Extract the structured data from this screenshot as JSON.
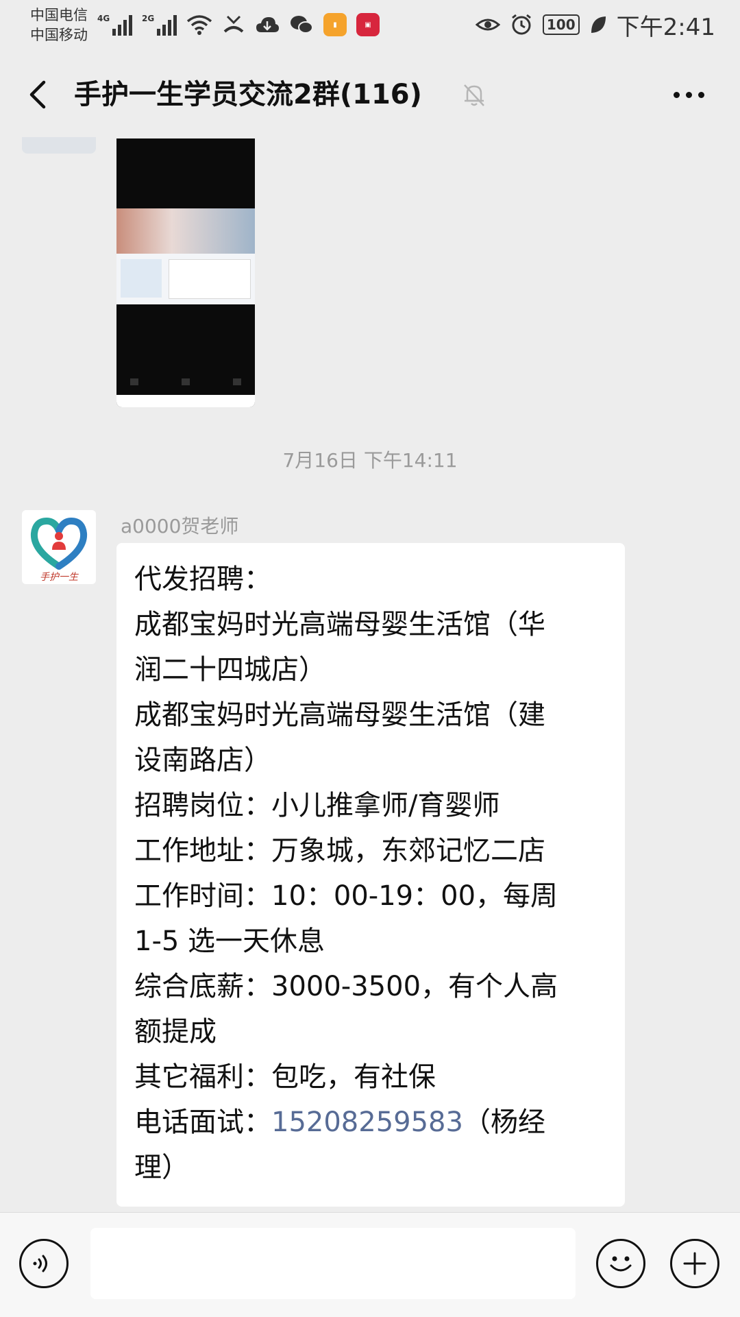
{
  "status_bar": {
    "carrier_1": "中国电信",
    "carrier_2": "中国移动",
    "network_1": "4G",
    "network_2": "2G",
    "battery": "100",
    "time": "下午2:41",
    "icons": [
      "signal-icon",
      "signal-icon",
      "wifi-icon",
      "missed-call-icon",
      "cloud-icon",
      "wechat-icon",
      "app-icon",
      "mall-app-icon",
      "eye-icon",
      "alarm-icon",
      "battery-icon",
      "leaf-icon"
    ]
  },
  "header": {
    "title": "手护一生学员交流2群(116)",
    "icons": [
      "back-arrow-icon",
      "mute-bell-icon",
      "more-icon"
    ]
  },
  "chat": {
    "timestamp": "7月16日 下午14:11",
    "message": {
      "sender": "a0000贺老师",
      "avatar_text": "手护一生",
      "lines": [
        "代发招聘：",
        "成都宝妈时光高端母婴生活馆（华",
        "润二十四城店）",
        "成都宝妈时光高端母婴生活馆（建",
        "设南路店）",
        "招聘岗位：小儿推拿师/育婴师",
        "工作地址：万象城，东郊记忆二店",
        "工作时间：10：00-19：00，每周",
        "1-5 选一天休息",
        "综合底薪：3000-3500，有个人高",
        "额提成",
        "其它福利：包吃，有社保"
      ],
      "phone_prefix": "电话面试：",
      "phone": "15208259583",
      "phone_suffix": "（杨经",
      "last_line": "理）"
    }
  },
  "input_bar": {
    "text_value": "",
    "icons": [
      "voice-icon",
      "emoji-icon",
      "plus-icon"
    ]
  },
  "colors": {
    "background": "#ededed",
    "bubble": "#ffffff",
    "link": "#576b95",
    "meta_text": "#9a9a9a"
  }
}
